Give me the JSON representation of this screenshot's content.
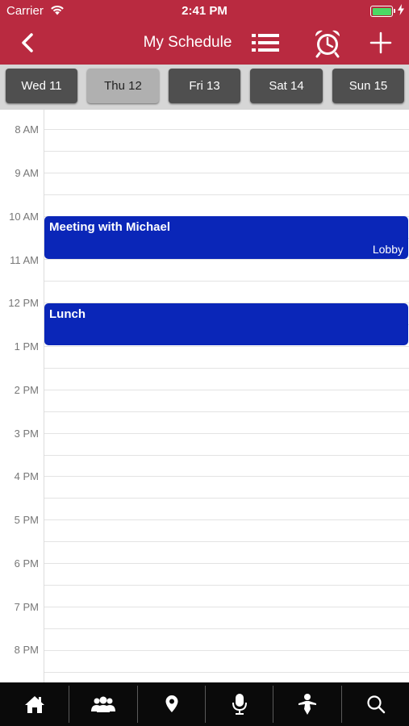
{
  "status_bar": {
    "carrier": "Carrier",
    "time": "2:41 PM",
    "battery_color": "#4cd964"
  },
  "nav": {
    "title": "My Schedule",
    "icons": [
      "back-chevron-icon",
      "list-icon",
      "alarm-clock-icon",
      "plus-icon"
    ],
    "background": "#b92a40"
  },
  "days": [
    {
      "label": "Wed 11",
      "selected": false
    },
    {
      "label": "Thu 12",
      "selected": true
    },
    {
      "label": "Fri 13",
      "selected": false
    },
    {
      "label": "Sat 14",
      "selected": false
    },
    {
      "label": "Sun 15",
      "selected": false
    }
  ],
  "hours": [
    "8 AM",
    "9 AM",
    "10 AM",
    "11 AM",
    "12 PM",
    "1 PM",
    "2 PM",
    "3 PM",
    "4 PM",
    "5 PM",
    "6 PM",
    "7 PM",
    "8 PM"
  ],
  "events": [
    {
      "title": "Meeting with Michael",
      "location": "Lobby",
      "color": "#0a26b8"
    },
    {
      "title": "Lunch",
      "location": "",
      "color": "#0a26b8"
    }
  ],
  "tabbar": {
    "icons": [
      "home-icon",
      "people-icon",
      "map-pin-icon",
      "microphone-icon",
      "speaker-icon",
      "search-icon"
    ]
  }
}
